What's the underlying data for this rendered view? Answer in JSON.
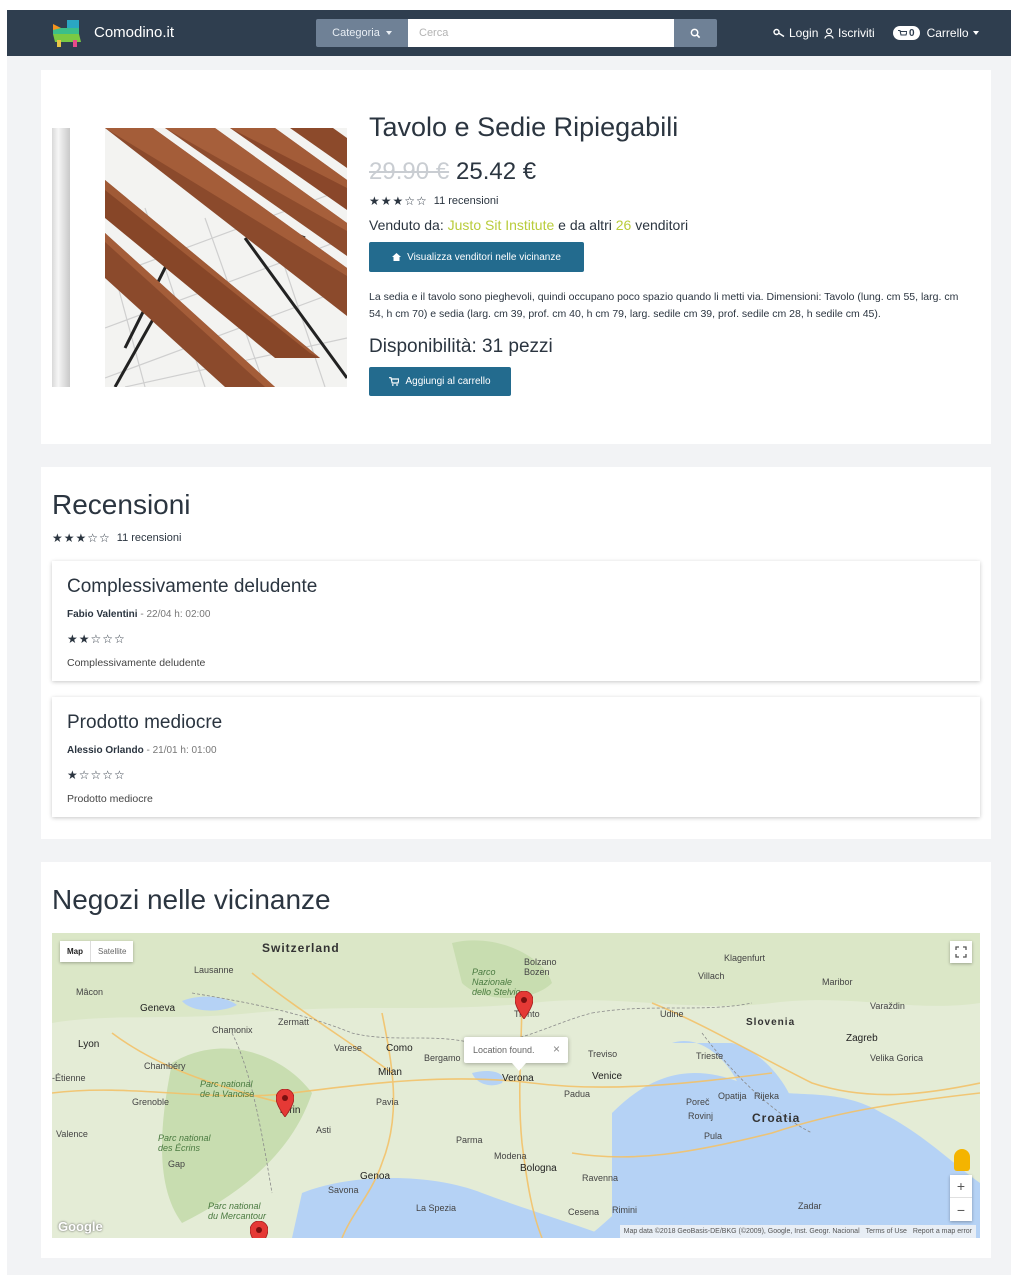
{
  "navbar": {
    "brand": "Comodino.it",
    "category_label": "Categoria",
    "search_placeholder": "Cerca",
    "login_label": "Login",
    "signup_label": "Iscriviti",
    "cart_count": "0",
    "cart_label": "Carrello"
  },
  "product": {
    "title": "Tavolo e Sedie Ripiegabili",
    "old_price": "29.90 €",
    "new_price": "25.42 €",
    "stars": "★★★☆☆",
    "review_count": "11 recensioni",
    "sold_by_prefix": "Venduto da:",
    "seller": "Justo Sit Institute",
    "sold_by_middle": "e da altri",
    "other_sellers": "26",
    "sold_by_suffix": "venditori",
    "nearby_vendors_button": "Visualizza venditori nelle vicinanze",
    "description": "La sedia e il tavolo sono pieghevoli, quindi occupano poco spazio quando li metti via. Dimensioni: Tavolo (lung. cm 55, larg. cm 54, h cm 70) e sedia (larg. cm 39, prof. cm 40, h cm 79, larg. sedile cm 39, prof. sedile cm 28, h sedile cm 45).",
    "availability": "Disponibilità: 31 pezzi",
    "add_to_cart_button": "Aggiungi al carrello"
  },
  "reviews": {
    "heading": "Recensioni",
    "summary_stars": "★★★☆☆",
    "summary_count": "11 recensioni",
    "items": [
      {
        "title": "Complessivamente deludente",
        "author": "Fabio Valentini",
        "date": "- 22/04  h: 02:00",
        "stars": "★★☆☆☆",
        "body": "Complessivamente deludente"
      },
      {
        "title": "Prodotto mediocre",
        "author": "Alessio Orlando",
        "date": "- 21/01  h: 01:00",
        "stars": "★☆☆☆☆",
        "body": "Prodotto mediocre"
      }
    ]
  },
  "map_section": {
    "heading": "Negozi nelle vicinanze",
    "map_type_map": "Map",
    "map_type_satellite": "Satellite",
    "popup_text": "Location found.",
    "popup_close": "×",
    "zoom_in": "+",
    "zoom_out": "−",
    "google_logo": "Google",
    "attribution": "Map data ©2018 GeoBasis-DE/BKG (©2009), Google, Inst. Geogr. Nacional",
    "terms": "Terms of Use",
    "report": "Report a map error",
    "labels": {
      "switzerland": "Switzerland",
      "slovenia": "Slovenia",
      "croatia": "Croatia",
      "lausanne": "Lausanne",
      "geneva": "Geneva",
      "macon": "Mâcon",
      "lyon": "Lyon",
      "chambery": "Chambéry",
      "grenoble": "Grenoble",
      "valence": "Valence",
      "etienne": "-Étienne",
      "chamonix": "Chamonix",
      "zermatt": "Zermatt",
      "varese": "Varese",
      "como": "Como",
      "bergamo": "Bergamo",
      "milan": "Milan",
      "pavia": "Pavia",
      "turin": "Turin",
      "asti": "Asti",
      "genoa": "Genoa",
      "savona": "Savona",
      "la_spezia": "La Spezia",
      "parma": "Parma",
      "modena": "Modena",
      "bologna": "Bologna",
      "ravenna": "Ravenna",
      "cesena": "Cesena",
      "rimini": "Rimini",
      "verona": "Verona",
      "padua": "Padua",
      "venice": "Venice",
      "treviso": "Treviso",
      "trento": "Trento",
      "bolzano": "Bolzano\nBozen",
      "udine": "Udine",
      "trieste": "Trieste",
      "villach": "Villach",
      "klagenfurt": "Klagenfurt",
      "maribor": "Maribor",
      "varazdin": "Varaždin",
      "zagreb": "Zagreb",
      "velika_gorica": "Velika Gorica",
      "rijeka": "Rijeka",
      "opatija": "Opatija",
      "porec": "Poreč",
      "rovinj": "Rovinj",
      "pula": "Pula",
      "zadar": "Zadar",
      "park_stelvio": "Parco\nNazionale\ndello Stelvio",
      "park_vanoise": "Parc national\nde la Vanoise",
      "park_ecrins": "Parc national\ndes Écrins",
      "park_mercantour": "Parc national\ndu Mercantour",
      "gap": "Gap"
    }
  },
  "colors": {
    "navbar_bg": "#2f3e4f",
    "primary_button": "#236b8e",
    "accent": "#b9cc3b",
    "page_bg": "#f2f3f5"
  }
}
